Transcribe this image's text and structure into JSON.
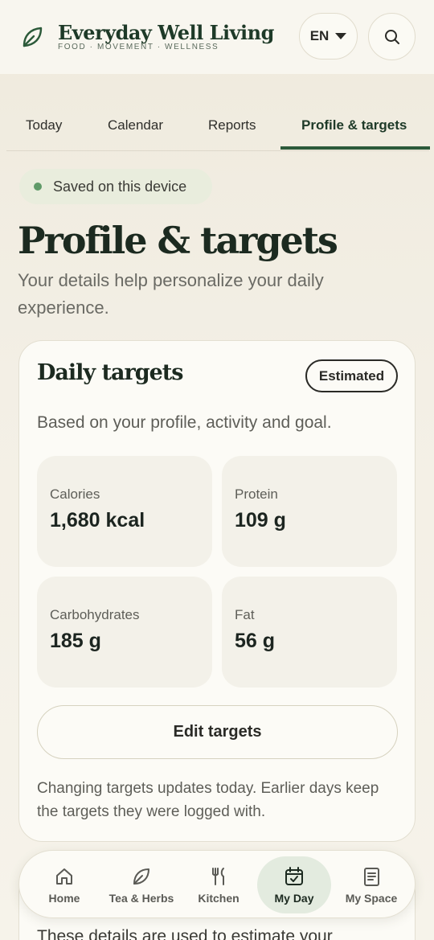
{
  "brand": {
    "title": "Everyday Well Living",
    "subtitle": "FOOD · MOVEMENT · WELLNESS",
    "icon": "leaf-icon"
  },
  "header": {
    "language": "EN",
    "search_icon": "search-icon"
  },
  "tabs": [
    {
      "label": "Today",
      "active": false
    },
    {
      "label": "Calendar",
      "active": false
    },
    {
      "label": "Reports",
      "active": false
    },
    {
      "label": "Profile & targets",
      "active": true
    }
  ],
  "status": {
    "saved_label": "Saved on this device"
  },
  "page": {
    "title": "Profile & targets",
    "description": "Your details help personalize your daily experience."
  },
  "daily_targets": {
    "title": "Daily targets",
    "badge": "Estimated",
    "description": "Based on your profile, activity and goal.",
    "items": [
      {
        "label": "Calories",
        "value": "1,680 kcal"
      },
      {
        "label": "Protein",
        "value": "109 g"
      },
      {
        "label": "Carbohydrates",
        "value": "185 g"
      },
      {
        "label": "Fat",
        "value": "56 g"
      }
    ],
    "edit_label": "Edit targets",
    "note": "Changing targets updates today. Earlier days keep the targets they were logged with."
  },
  "next_card": {
    "partial_text": "These details are used to estimate your"
  },
  "bottom_nav": [
    {
      "label": "Home",
      "icon": "home-icon",
      "active": false
    },
    {
      "label": "Tea & Herbs",
      "icon": "leaf-icon",
      "active": false
    },
    {
      "label": "Kitchen",
      "icon": "utensils-icon",
      "active": false
    },
    {
      "label": "My Day",
      "icon": "calendar-check-icon",
      "active": true
    },
    {
      "label": "My Space",
      "icon": "notebook-icon",
      "active": false
    }
  ],
  "colors": {
    "accent": "#2c5a3a",
    "status_dot": "#5f9a68",
    "active_nav_bg": "#e3ebdf"
  }
}
